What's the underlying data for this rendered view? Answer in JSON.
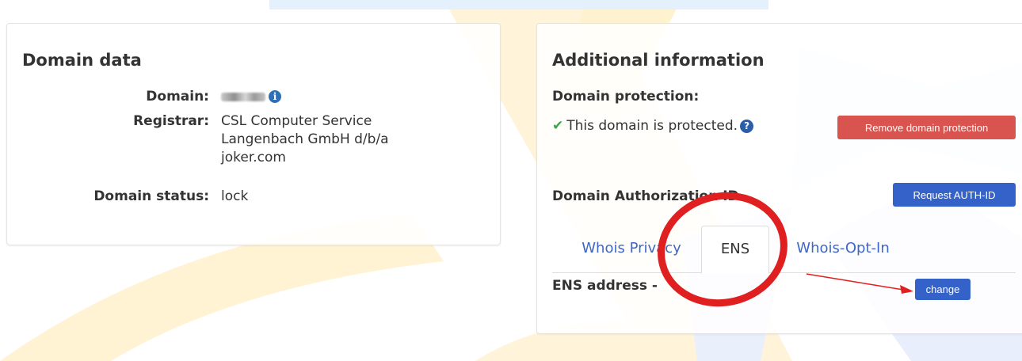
{
  "domain_data": {
    "title": "Domain data",
    "rows": [
      {
        "key": "Domain:",
        "value": ""
      },
      {
        "key": "Registrar:",
        "value": "CSL Computer Service Langenbach GmbH d/b/a joker.com"
      },
      {
        "key": "Domain status:",
        "value": "lock"
      }
    ]
  },
  "additional": {
    "title": "Additional information",
    "protection_label": "Domain protection:",
    "protection_status": "This domain is protected.",
    "remove_protection_button": "Remove domain protection",
    "auth_label": "Domain Authorization ID",
    "request_auth_button": "Request AUTH-ID",
    "tabs": [
      {
        "label": "Whois Privacy",
        "active": false
      },
      {
        "label": "ENS",
        "active": true
      },
      {
        "label": "Whois-Opt-In",
        "active": false
      }
    ],
    "ens_label": "ENS address -",
    "change_button": "change"
  },
  "icons": {
    "info": "info-circle-icon",
    "help": "question-circle-icon",
    "check": "check-icon"
  },
  "colors": {
    "accent_blue": "#3562c9",
    "danger_red": "#d9534f",
    "success_green": "#3aa64a",
    "annotation_red": "#e02020"
  }
}
